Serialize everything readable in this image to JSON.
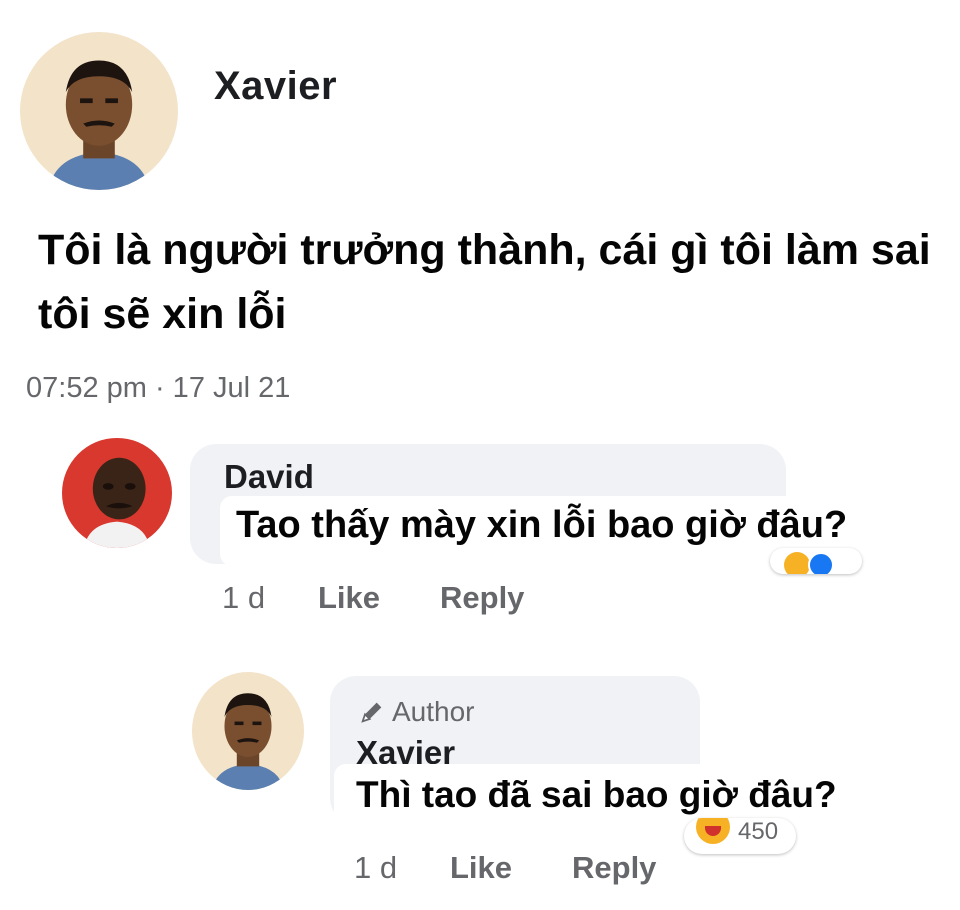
{
  "post": {
    "author": "Xavier",
    "text": "Tôi là người trưởng thành, cái gì tôi làm sai tôi sẽ xin lỗi",
    "timestamp": "07:52 pm · 17 Jul 21"
  },
  "comments": [
    {
      "name": "David",
      "text": "Tao thấy mày xin lỗi bao giờ đâu?",
      "time": "1 d",
      "like_label": "Like",
      "reply_label": "Reply",
      "reactions": [
        "haha",
        "like"
      ]
    },
    {
      "badge": "Author",
      "badge_icon": "pencil-icon",
      "name": "Xavier",
      "text": "Thì tao đã sai bao giờ đâu?",
      "time": "1 d",
      "like_label": "Like",
      "reply_label": "Reply",
      "reaction_count": "450",
      "reactions": [
        "haha"
      ]
    }
  ],
  "colors": {
    "bubble": "#f0f2f5",
    "meta_text": "#65676b",
    "main_text": "#050505"
  }
}
